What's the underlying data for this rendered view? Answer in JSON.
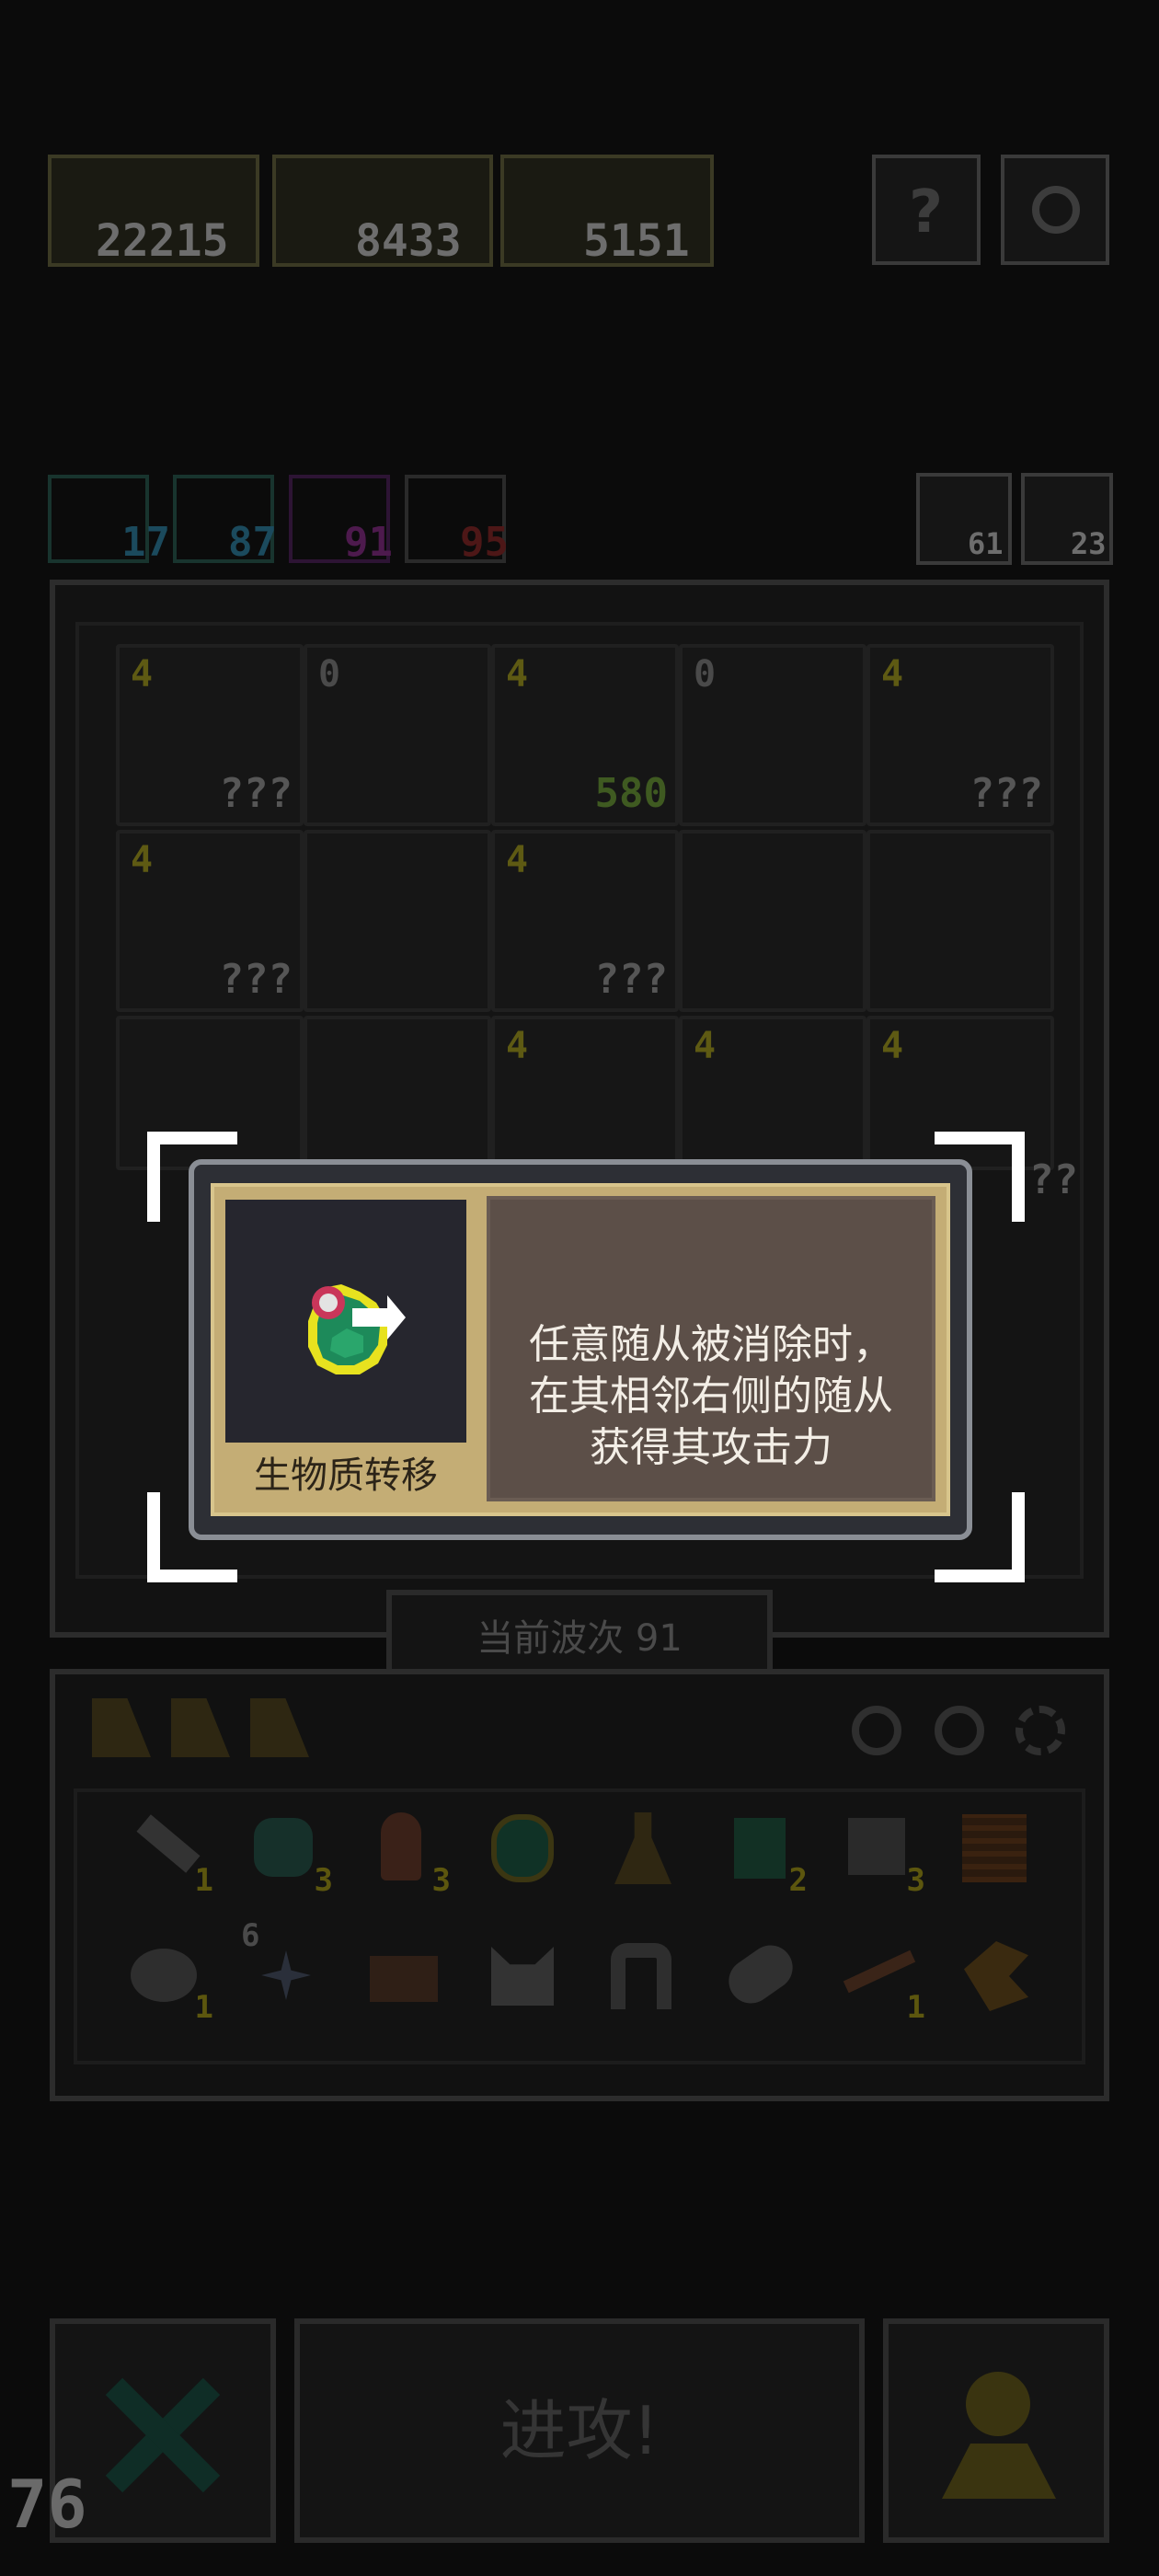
{
  "top_bar": {
    "scores": [
      "22215",
      "8433",
      "5151"
    ],
    "help_label": "?"
  },
  "resources": {
    "values": [
      "17",
      "87",
      "91",
      "95"
    ],
    "right_values": [
      "61",
      "23"
    ]
  },
  "board": {
    "row1": [
      {
        "level": "4",
        "hp": "???"
      },
      {
        "level": "0",
        "hp": ""
      },
      {
        "level": "4",
        "hp": "580"
      },
      {
        "level": "0",
        "hp": ""
      },
      {
        "level": "4",
        "hp": "???"
      }
    ],
    "row2": [
      {
        "level": "4",
        "hp": "???"
      },
      {
        "level": "",
        "hp": ""
      },
      {
        "level": "4",
        "hp": "???"
      },
      {
        "level": "",
        "hp": ""
      },
      {
        "level": "",
        "hp": ""
      }
    ],
    "row3": [
      {
        "level": "",
        "hp": ""
      },
      {
        "level": "",
        "hp": ""
      },
      {
        "level": "4",
        "hp": ""
      },
      {
        "level": "4",
        "hp": ""
      },
      {
        "level": "4",
        "hp": "??"
      }
    ],
    "wave_label": "当前波次 91"
  },
  "inventory": {
    "row1_counts": [
      "1",
      "3",
      "3",
      "",
      "",
      "2",
      "3",
      ""
    ],
    "row2_counts": [
      "1",
      "6",
      "",
      "",
      "",
      "",
      "1",
      ""
    ]
  },
  "bottom": {
    "attack_label": "进攻!",
    "counter": "76"
  },
  "tooltip": {
    "item_name": "生物质转移",
    "description_lines": [
      "任意随从被消除时，",
      "在其相邻右侧的随从",
      "获得其攻击力"
    ]
  },
  "colors": {
    "frame": "#8a8e95",
    "card_tan": "#c4ad75",
    "desc_bg": "#5c4f48",
    "potion_green": "#1d8a5a",
    "potion_outline": "#e7e21f"
  }
}
